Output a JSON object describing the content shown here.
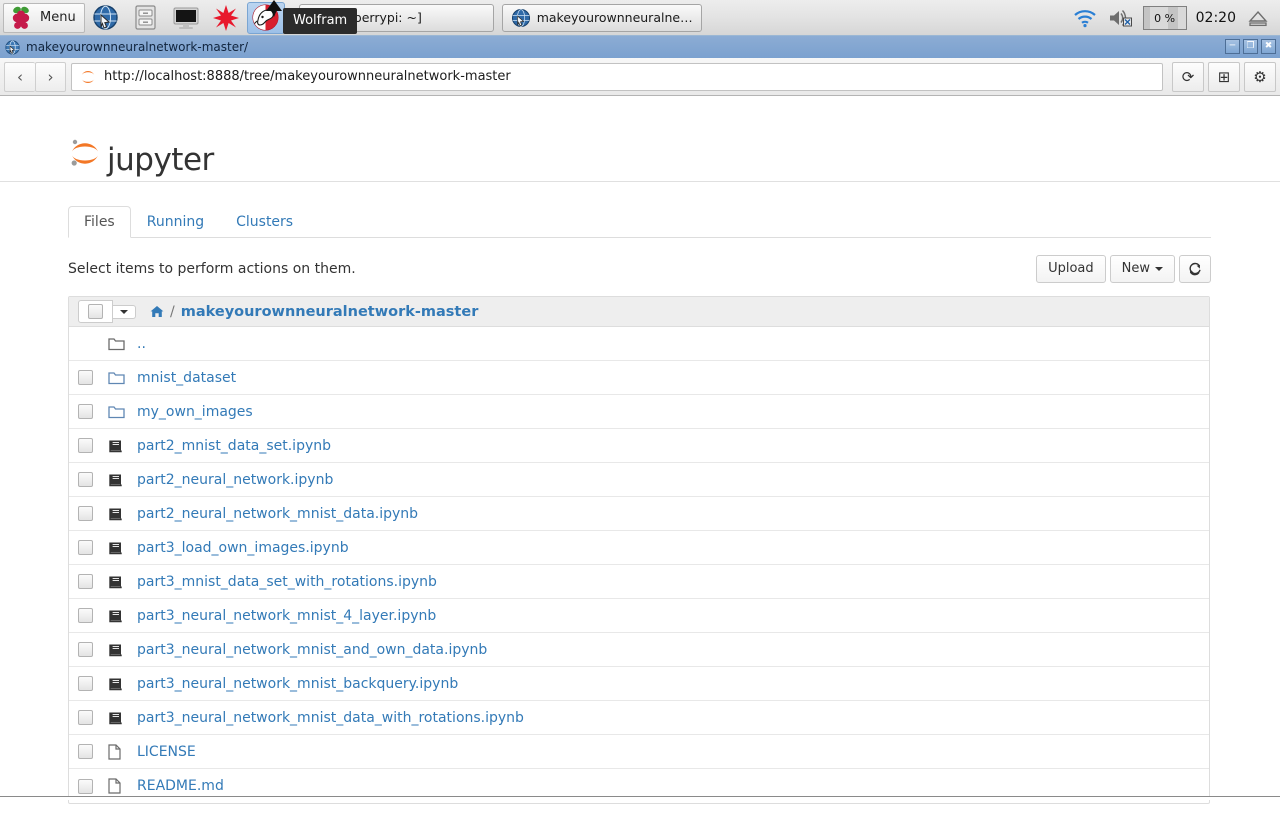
{
  "taskbar": {
    "menu_label": "Menu",
    "launchers": [
      {
        "name": "raspberry-menu-icon",
        "label": "Menu"
      },
      {
        "name": "web-browser-icon",
        "label": "Web Browser"
      },
      {
        "name": "file-manager-icon",
        "label": "File Manager"
      },
      {
        "name": "terminal-icon",
        "label": "Terminal"
      },
      {
        "name": "mathematica-icon",
        "label": "Mathematica"
      },
      {
        "name": "wolfram-icon",
        "label": "Wolfram"
      }
    ],
    "tooltip": "Wolfram",
    "windows": [
      {
        "title": "aspberrypi: ~]",
        "icon": "terminal-icon"
      },
      {
        "title": "makeyourownneuralnetwor...",
        "icon": "web-browser-icon"
      }
    ],
    "tray": {
      "wifi_icon": "wifi-icon",
      "volume_icon": "volume-muted-icon",
      "cpu_label": "0 %",
      "clock": "02:20",
      "eject_icon": "eject-icon"
    }
  },
  "window": {
    "title": "makeyourownneuralnetwork-master/",
    "controls": {
      "minimize": "minimize-icon",
      "maximize": "maximize-icon",
      "close": "close-icon"
    }
  },
  "browser": {
    "back_label": "‹",
    "forward_label": "›",
    "url": "http://localhost:8888/tree/makeyourownneuralnetwork-master",
    "reload_label": "⟳",
    "newtab_label": "⊞",
    "settings_label": "⚙"
  },
  "jupyter": {
    "wordmark": "jupyter",
    "tabs": [
      {
        "label": "Files",
        "active": true
      },
      {
        "label": "Running",
        "active": false
      },
      {
        "label": "Clusters",
        "active": false
      }
    ],
    "select_hint": "Select items to perform actions on them.",
    "buttons": {
      "upload": "Upload",
      "new": "New",
      "refresh_icon": "refresh-icon"
    },
    "breadcrumb": {
      "home_icon": "home-icon",
      "separator": "/",
      "path": "makeyourownneuralnetwork-master"
    },
    "files": [
      {
        "name": "..",
        "type": "parent",
        "checkbox": false
      },
      {
        "name": "mnist_dataset",
        "type": "folder",
        "checkbox": true
      },
      {
        "name": "my_own_images",
        "type": "folder",
        "checkbox": true
      },
      {
        "name": "part2_mnist_data_set.ipynb",
        "type": "notebook",
        "checkbox": true
      },
      {
        "name": "part2_neural_network.ipynb",
        "type": "notebook",
        "checkbox": true
      },
      {
        "name": "part2_neural_network_mnist_data.ipynb",
        "type": "notebook",
        "checkbox": true
      },
      {
        "name": "part3_load_own_images.ipynb",
        "type": "notebook",
        "checkbox": true
      },
      {
        "name": "part3_mnist_data_set_with_rotations.ipynb",
        "type": "notebook",
        "checkbox": true
      },
      {
        "name": "part3_neural_network_mnist_4_layer.ipynb",
        "type": "notebook",
        "checkbox": true
      },
      {
        "name": "part3_neural_network_mnist_and_own_data.ipynb",
        "type": "notebook",
        "checkbox": true
      },
      {
        "name": "part3_neural_network_mnist_backquery.ipynb",
        "type": "notebook",
        "checkbox": true
      },
      {
        "name": "part3_neural_network_mnist_data_with_rotations.ipynb",
        "type": "notebook",
        "checkbox": true
      },
      {
        "name": "LICENSE",
        "type": "file",
        "checkbox": true
      },
      {
        "name": "README.md",
        "type": "file",
        "checkbox": true
      }
    ]
  },
  "colors": {
    "link": "#337ab7",
    "jupyter_orange": "#f37726",
    "titlebar": "#7ba1cf",
    "header_gray": "#eeeeee"
  }
}
